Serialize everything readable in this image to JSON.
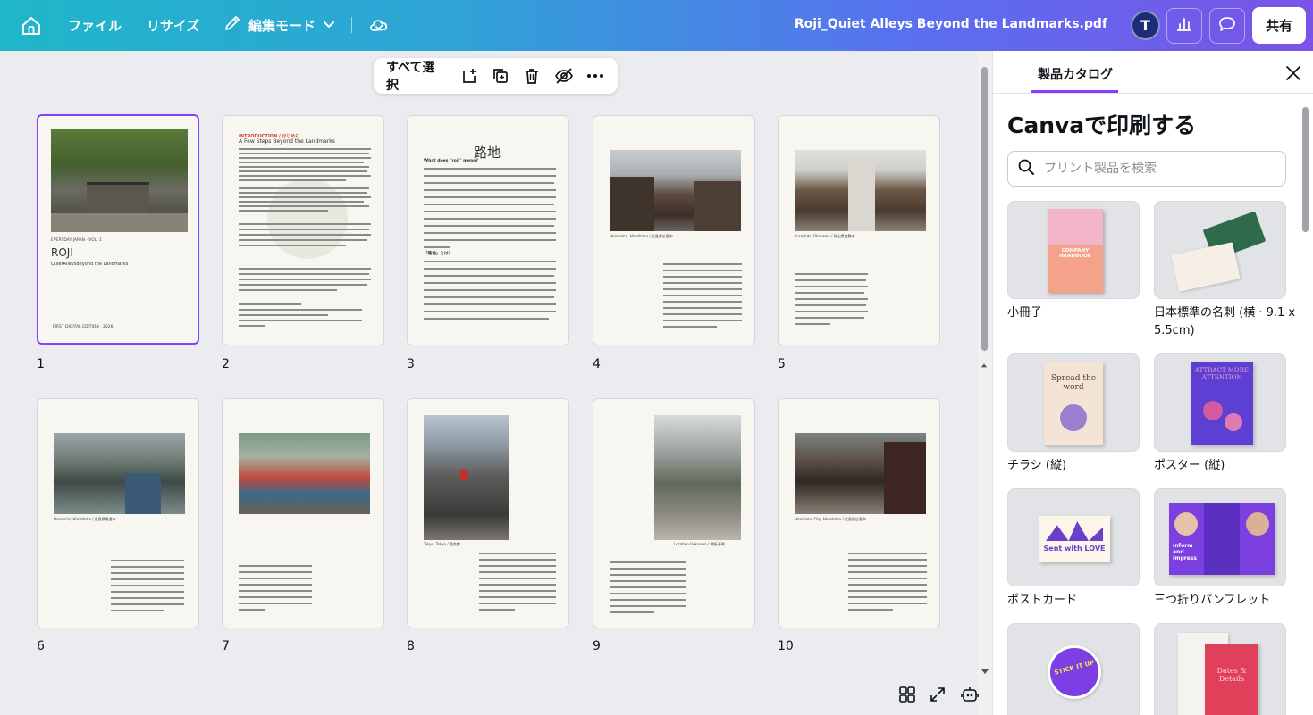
{
  "header": {
    "file_label": "ファイル",
    "resize_label": "リサイズ",
    "edit_mode_label": "編集モード",
    "document_title": "Roji_Quiet Alleys Beyond the Landmarks.pdf",
    "avatar_initial": "T",
    "share_label": "共有"
  },
  "selection_toolbar": {
    "select_all_label": "すべて選択"
  },
  "pages": [
    {
      "number": "1",
      "selected": true
    },
    {
      "number": "2"
    },
    {
      "number": "3"
    },
    {
      "number": "4"
    },
    {
      "number": "5"
    },
    {
      "number": "6"
    },
    {
      "number": "7"
    },
    {
      "number": "8"
    },
    {
      "number": "9"
    },
    {
      "number": "10"
    }
  ],
  "page_content": {
    "p1": {
      "series": "EVERYDAY JAPAN · VOL. 1",
      "title": "ROJI",
      "subtitle": "QuietAlleysBeyond the Landmarks",
      "edition": "FIRST DIGITAL EDITION · 2026"
    },
    "p2": {
      "heading": "INTRODUCTION / はじめに",
      "subheading": "A Few Steps Beyond the Landmarks"
    },
    "p3": {
      "kanji": "路地",
      "question": "What does \"roji\" mean?",
      "section": "「路地」とは？"
    },
    "p4": {
      "caption": "Hiroshima, Hiroshima / 広島県広島市"
    },
    "p5": {
      "caption": "Kurashiki, Okayama / 岡山県倉敷市"
    },
    "p6": {
      "caption": "Onomichi, Hiroshima / 広島県尾道市"
    },
    "p8": {
      "caption": "Tokyo, Tokyo / 東京都"
    },
    "p9": {
      "caption": "Location Unknown / 場所不明"
    },
    "p10": {
      "caption": "Hiroshima City, Hiroshima / 広島県広島市"
    }
  },
  "panel": {
    "tab_label": "製品カタログ",
    "heading": "Canvaで印刷する",
    "search_placeholder": "プリント製品を検索",
    "products": [
      {
        "label": "小冊子",
        "thumb_text": "COMPANY HANDBOOK"
      },
      {
        "label": "日本標準の名刺 (横 · 9.1 x 5.5cm)"
      },
      {
        "label": "チラシ (縦)",
        "thumb_text": "Spread the word"
      },
      {
        "label": "ポスター (縦)",
        "thumb_text": "ATTRACT MORE ATTENTION"
      },
      {
        "label": "ポストカード",
        "thumb_text": "Sent with LOVE"
      },
      {
        "label": "三つ折りパンフレット",
        "thumb_text": "Inform and Impress"
      },
      {
        "label": "",
        "thumb_text": "STICK IT UP"
      },
      {
        "label": "",
        "thumb_text": "Dates & Details"
      }
    ]
  },
  "colors": {
    "accent": "#8b3dff",
    "header_gradient_start": "#1fb6c9",
    "header_gradient_end": "#7a53e6"
  }
}
